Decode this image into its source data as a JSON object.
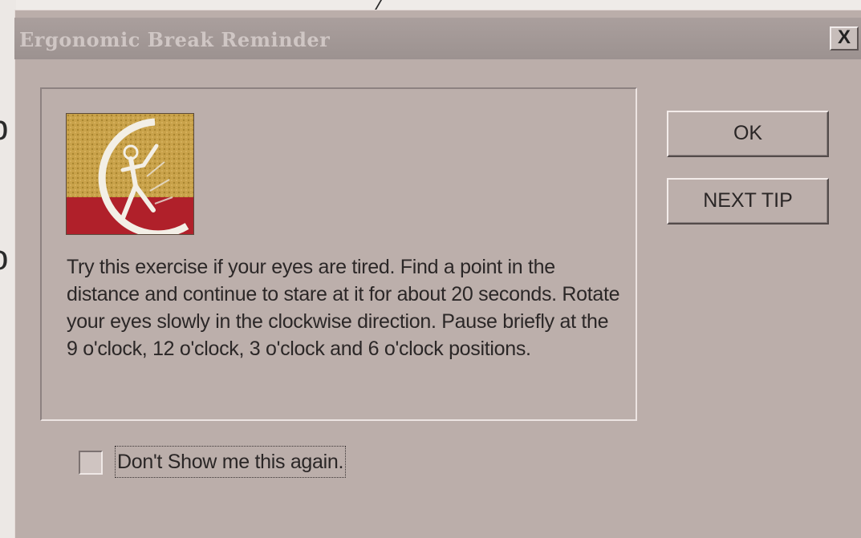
{
  "window": {
    "title": "Ergonomic Break Reminder",
    "close_label": "X"
  },
  "tip": {
    "text": "Try this exercise if your eyes are tired.  Find a point in the distance and continue to stare at it for about 20 seconds.  Rotate your eyes slowly in the clockwise direction.  Pause briefly at the 9 o'clock, 12 o'clock, 3 o'clock and 6 o'clock positions."
  },
  "buttons": {
    "ok_label": "OK",
    "next_tip_label": "NEXT TIP"
  },
  "option": {
    "dont_show_label": "Don't Show me this again.",
    "checked": false
  },
  "icons": {
    "logo": "stretching-figure-logo-icon",
    "close": "close-icon",
    "checkbox": "checkbox-unchecked-icon"
  },
  "colors": {
    "dialog_face": "#bcafab",
    "titlebar_inactive": "#a39896",
    "title_text": "#cfc6c4",
    "logo_gold": "#c9a24a",
    "logo_red": "#b0202a"
  }
}
